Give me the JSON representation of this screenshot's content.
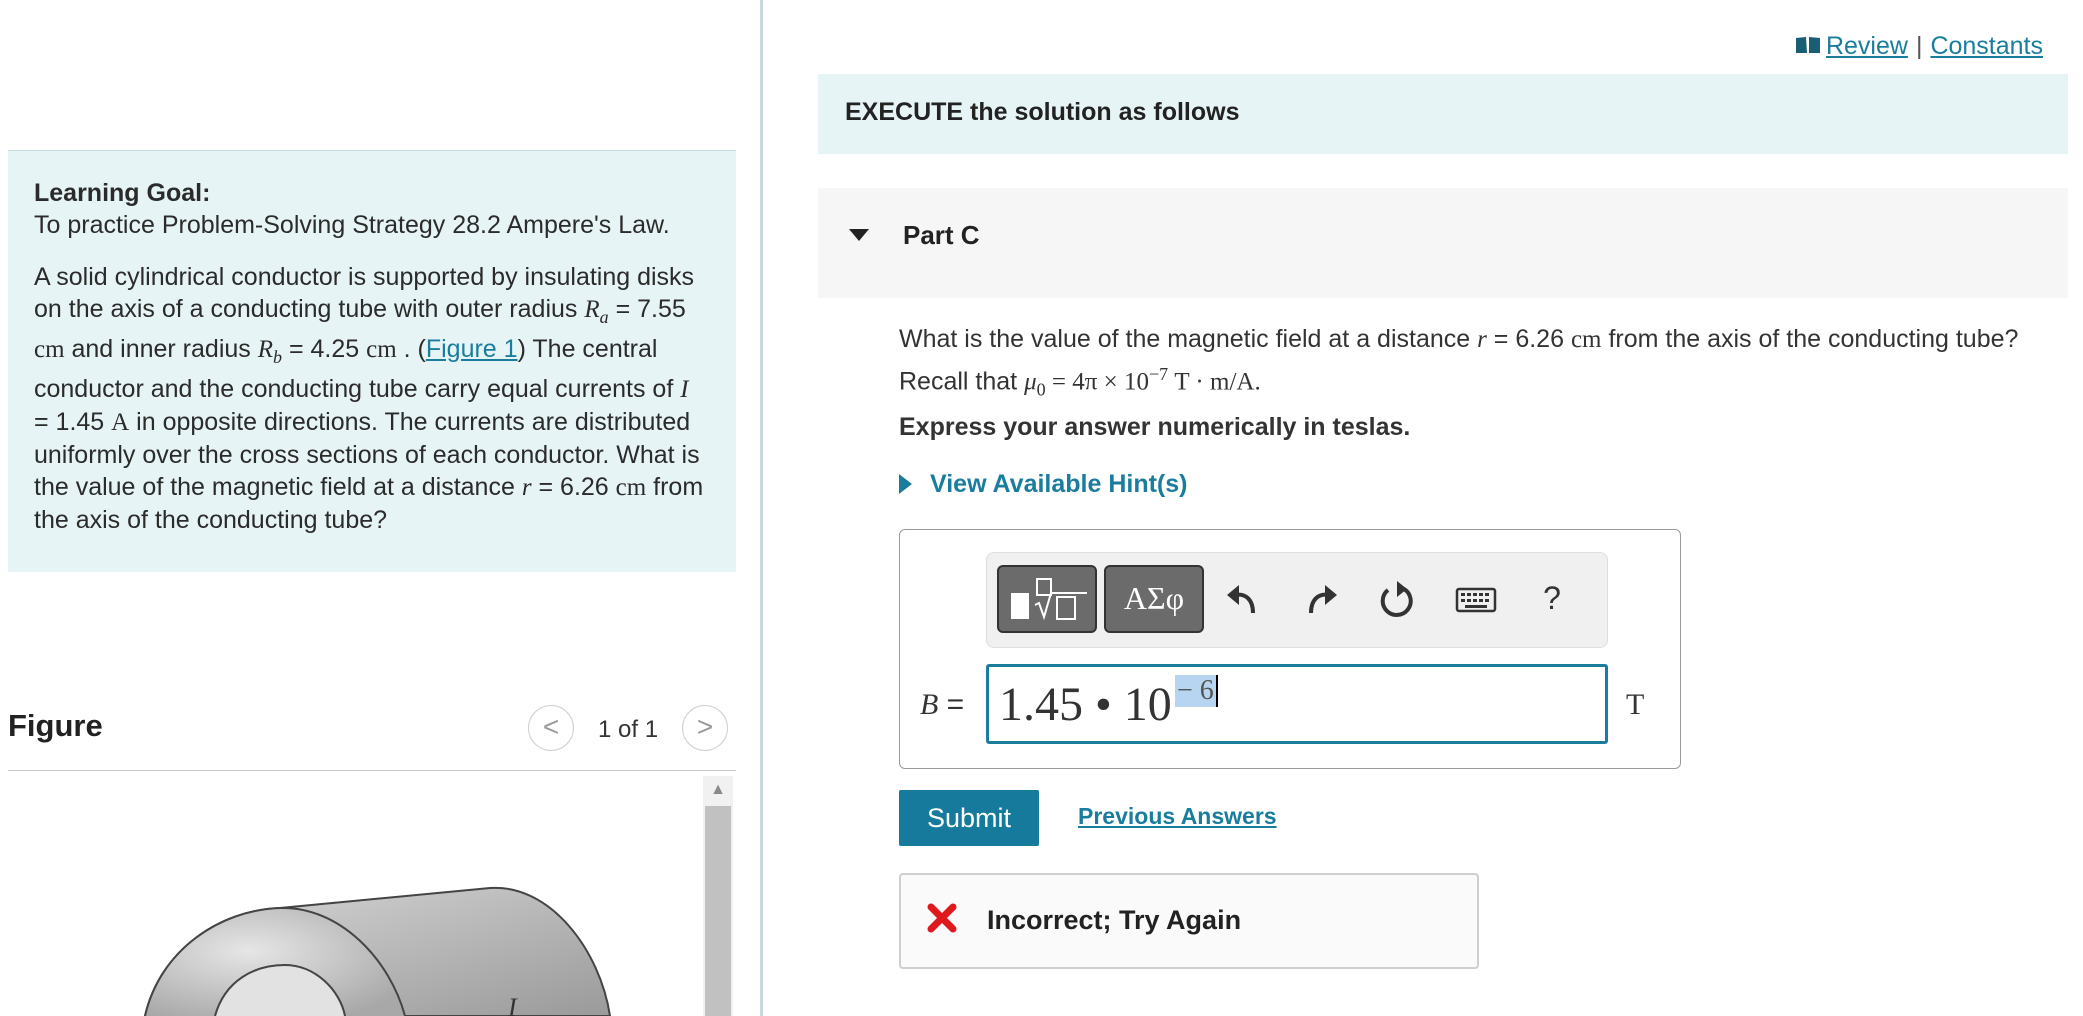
{
  "learning_goal": {
    "heading": "Learning Goal:",
    "intro": "To practice Problem-Solving Strategy 28.2 Ampere's Law.",
    "p1": "A solid cylindrical conductor is supported by insulating disks on the axis of a conducting tube with outer radius",
    "ra_symbol": "R",
    "ra_sub": "a",
    "ra_eq": " = 7.55 ",
    "ra_unit": "cm",
    "and_inner": " and inner radius ",
    "rb_symbol": "R",
    "rb_sub": "b",
    "rb_eq": " = 4.25 ",
    "rb_unit": "cm",
    "open_paren": " . (",
    "figure_link": "Figure 1",
    "close_paren": ")",
    "p2": "The central conductor and the conducting tube carry equal currents of ",
    "i_symbol": "I",
    "i_eq": " = 1.45 ",
    "i_unit": "A",
    "p3": " in opposite directions. The currents are distributed uniformly over the cross sections of each conductor. What is the value of the magnetic field at a distance ",
    "r_symbol": "r",
    "r_eq": " = 6.26 ",
    "r_unit": "cm",
    "p4": " from the axis of the conducting tube?"
  },
  "figure": {
    "title": "Figure",
    "counter": "1 of 1",
    "prev_glyph": "<",
    "next_glyph": ">",
    "scroll_up_glyph": "▲",
    "current_label": "I"
  },
  "header_links": {
    "review": "Review",
    "separator": "|",
    "constants": "Constants"
  },
  "execute_banner": "EXECUTE the solution as follows",
  "part": {
    "title": "Part C",
    "question_pre": "What is the value of the magnetic field at a distance ",
    "r_symbol": "r",
    "r_eq": " = 6.26 ",
    "r_unit": "cm",
    "question_mid": " from the axis of the conducting tube? Recall that ",
    "mu_symbol": "μ",
    "mu_sub": "0",
    "mu_eq": " = 4π × 10",
    "mu_exp": "−7",
    "mu_unit": " T · m/A.",
    "instruction": "Express your answer numerically in teslas.",
    "hint_link": "View Available Hint(s)"
  },
  "toolbar": {
    "symbols_label": "ΑΣφ",
    "help_label": "?"
  },
  "answer": {
    "variable": "B",
    "equals": " =",
    "base": "1.45 • 10",
    "exponent": "− 6",
    "unit": "T"
  },
  "buttons": {
    "submit": "Submit",
    "previous_answers": "Previous Answers"
  },
  "feedback": {
    "text": "Incorrect; Try Again"
  },
  "colors": {
    "accent": "#1a7d9e",
    "panel_bg": "#e6f4f5",
    "error_red": "#e0191d"
  }
}
